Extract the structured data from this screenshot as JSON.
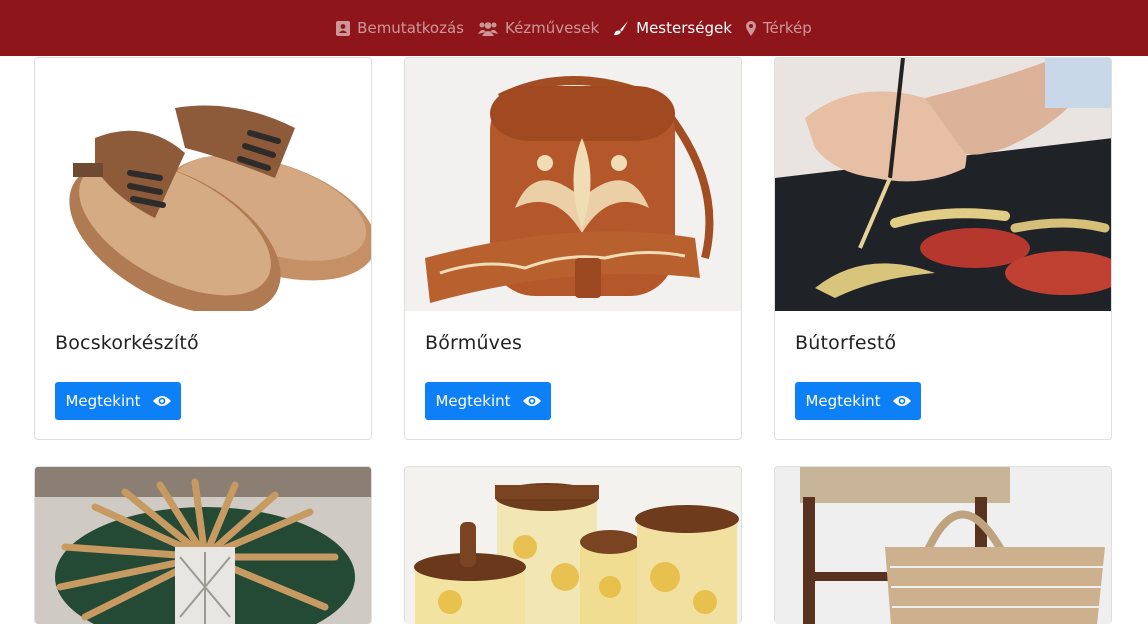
{
  "nav": {
    "items": [
      {
        "label": "Bemutatkozás",
        "icon": "address-card-icon",
        "active": false
      },
      {
        "label": "Kézművesek",
        "icon": "users-icon",
        "active": false
      },
      {
        "label": "Mesterségek",
        "icon": "paint-brush-icon",
        "active": true
      },
      {
        "label": "Térkép",
        "icon": "map-marker-icon",
        "active": false
      }
    ]
  },
  "cards": [
    {
      "title": "Bocskorkészítő",
      "button": "Megtekint",
      "image": "leather-shoes"
    },
    {
      "title": "Bőrműves",
      "button": "Megtekint",
      "image": "leather-bag"
    },
    {
      "title": "Bútorfestő",
      "button": "Megtekint",
      "image": "furniture-painting"
    },
    {
      "image": "bobbin-lace"
    },
    {
      "image": "painted-ceramics"
    },
    {
      "image": "woven-basket"
    }
  ],
  "colors": {
    "navbar": "#8e161b",
    "button": "#0d80f7"
  }
}
